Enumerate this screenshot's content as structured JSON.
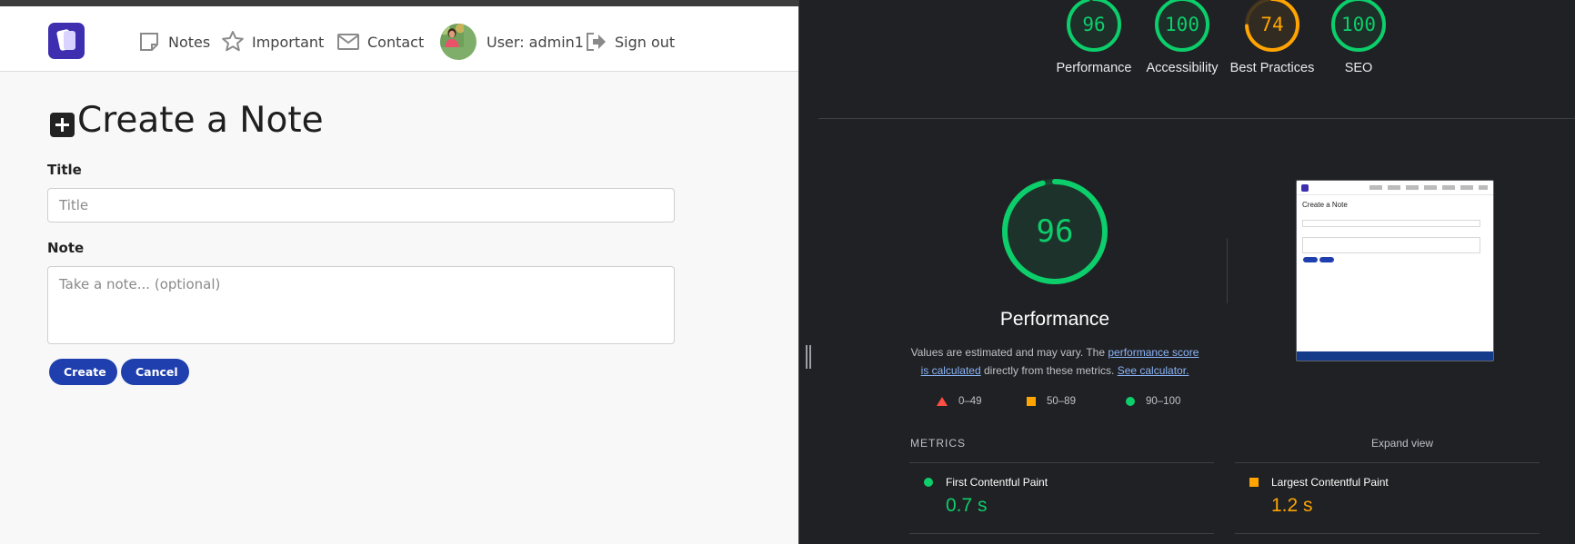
{
  "app": {
    "nav": {
      "notes": "Notes",
      "important": "Important",
      "contact": "Contact",
      "user": "User: admin1",
      "signout": "Sign out"
    },
    "page_title": "Create a Note",
    "form": {
      "title_label": "Title",
      "title_placeholder": "Title",
      "title_value": "",
      "note_label": "Note",
      "note_placeholder": "Take a note... (optional)",
      "note_value": "",
      "create_label": "Create",
      "cancel_label": "Cancel"
    }
  },
  "lighthouse": {
    "categories": [
      {
        "label": "Performance",
        "score": 96,
        "status": "pass"
      },
      {
        "label": "Accessibility",
        "score": 100,
        "status": "pass"
      },
      {
        "label": "Best Practices",
        "score": 74,
        "status": "average"
      },
      {
        "label": "SEO",
        "score": 100,
        "status": "pass"
      }
    ],
    "performance": {
      "score": 96,
      "title": "Performance",
      "desc_prefix": "Values are estimated and may vary. The ",
      "desc_link1": "performance score is calculated",
      "desc_middle": " directly from these metrics. ",
      "desc_link2": "See calculator."
    },
    "legend": {
      "fail": "0–49",
      "average": "50–89",
      "pass": "90–100"
    },
    "screenshot_title": "Create a Note",
    "metrics": {
      "header": "METRICS",
      "expand": "Expand view",
      "items": [
        {
          "label": "First Contentful Paint",
          "value": "0.7 s",
          "status": "pass"
        },
        {
          "label": "Largest Contentful Paint",
          "value": "1.2 s",
          "status": "average"
        }
      ]
    },
    "colors": {
      "pass": "#0cce6b",
      "average": "#ffa400",
      "fail": "#ff4e42",
      "background": "#202124"
    }
  }
}
